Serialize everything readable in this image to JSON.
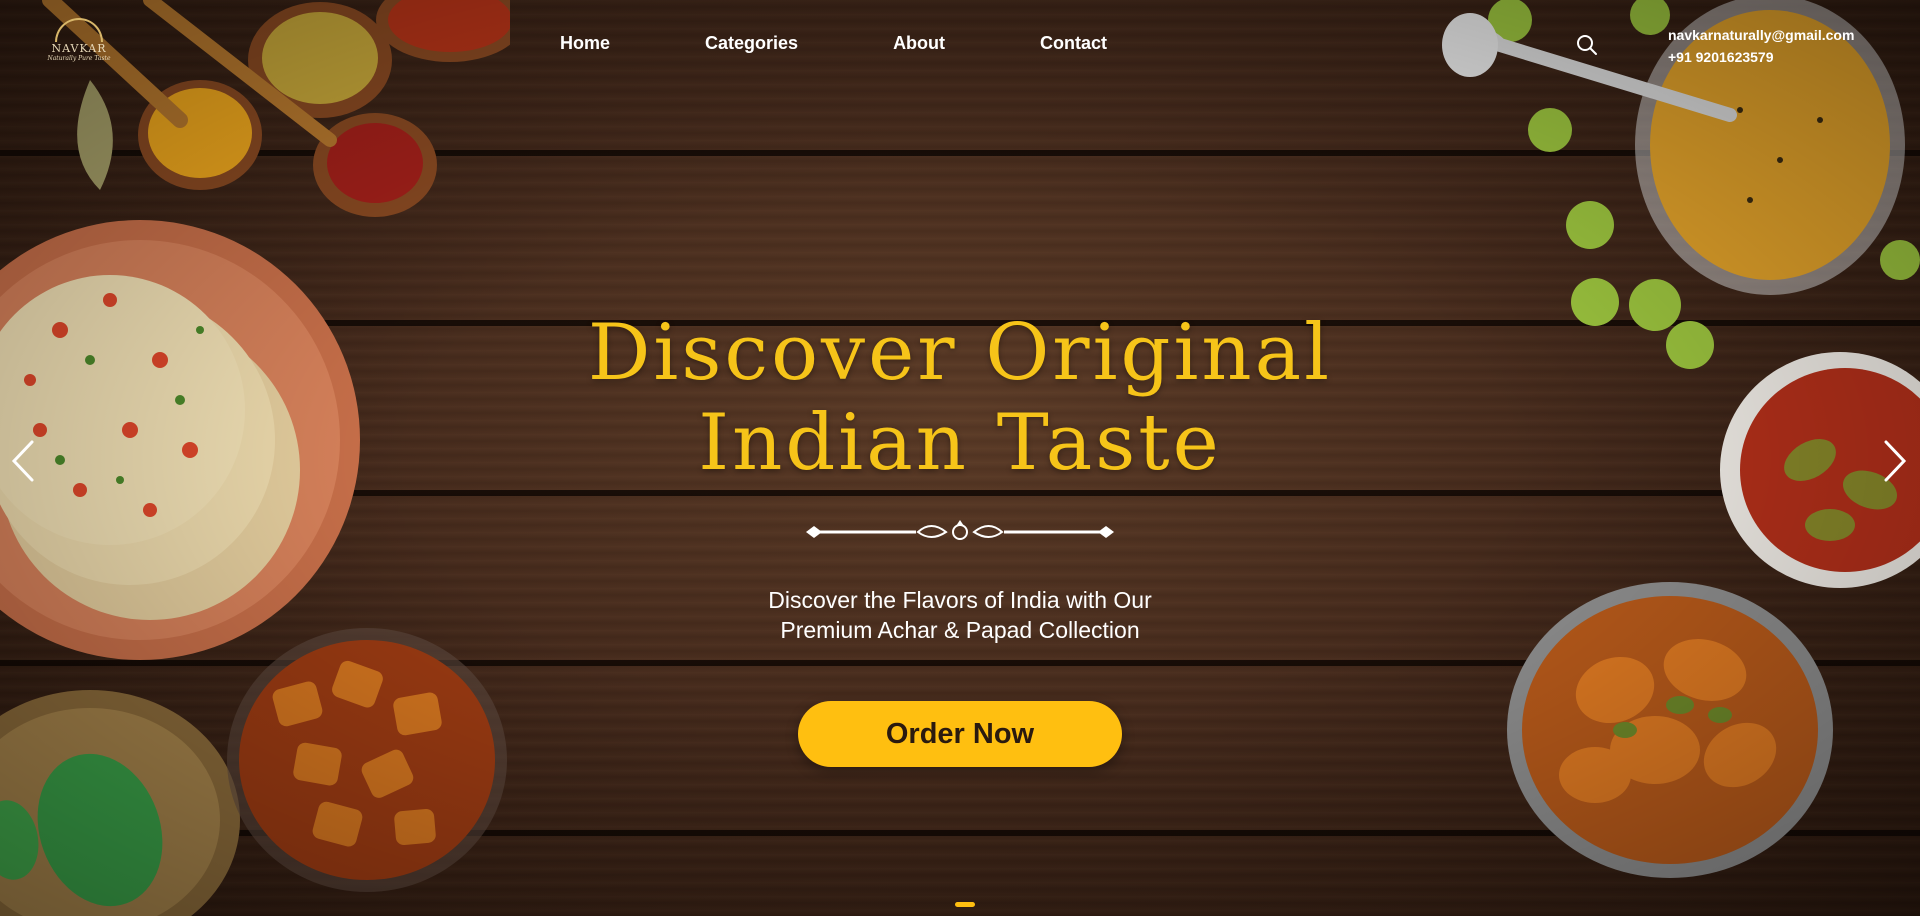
{
  "brand": {
    "name": "NAVKAR",
    "tagline": "Naturally Pure Taste"
  },
  "nav": {
    "items": [
      {
        "label": "Home"
      },
      {
        "label": "Categories"
      },
      {
        "label": "About"
      },
      {
        "label": "Contact"
      }
    ]
  },
  "header": {
    "search_icon": "search-icon",
    "email": "navkarnaturally@gmail.com",
    "phone": "+91 9201623579"
  },
  "hero": {
    "title_line1": "Discover Original",
    "title_line2": "Indian Taste",
    "subtitle_line1": "Discover the Flavors of India with Our",
    "subtitle_line2": "Premium Achar & Papad Collection",
    "cta_label": "Order Now"
  },
  "carousel": {
    "prev_icon": "chevron-left-icon",
    "next_icon": "chevron-right-icon",
    "active_slide": 1
  },
  "colors": {
    "accent": "#ffbf10",
    "title": "#f6c419",
    "wood_dark": "#2a170d",
    "wood_mid": "#4a2d1d"
  }
}
